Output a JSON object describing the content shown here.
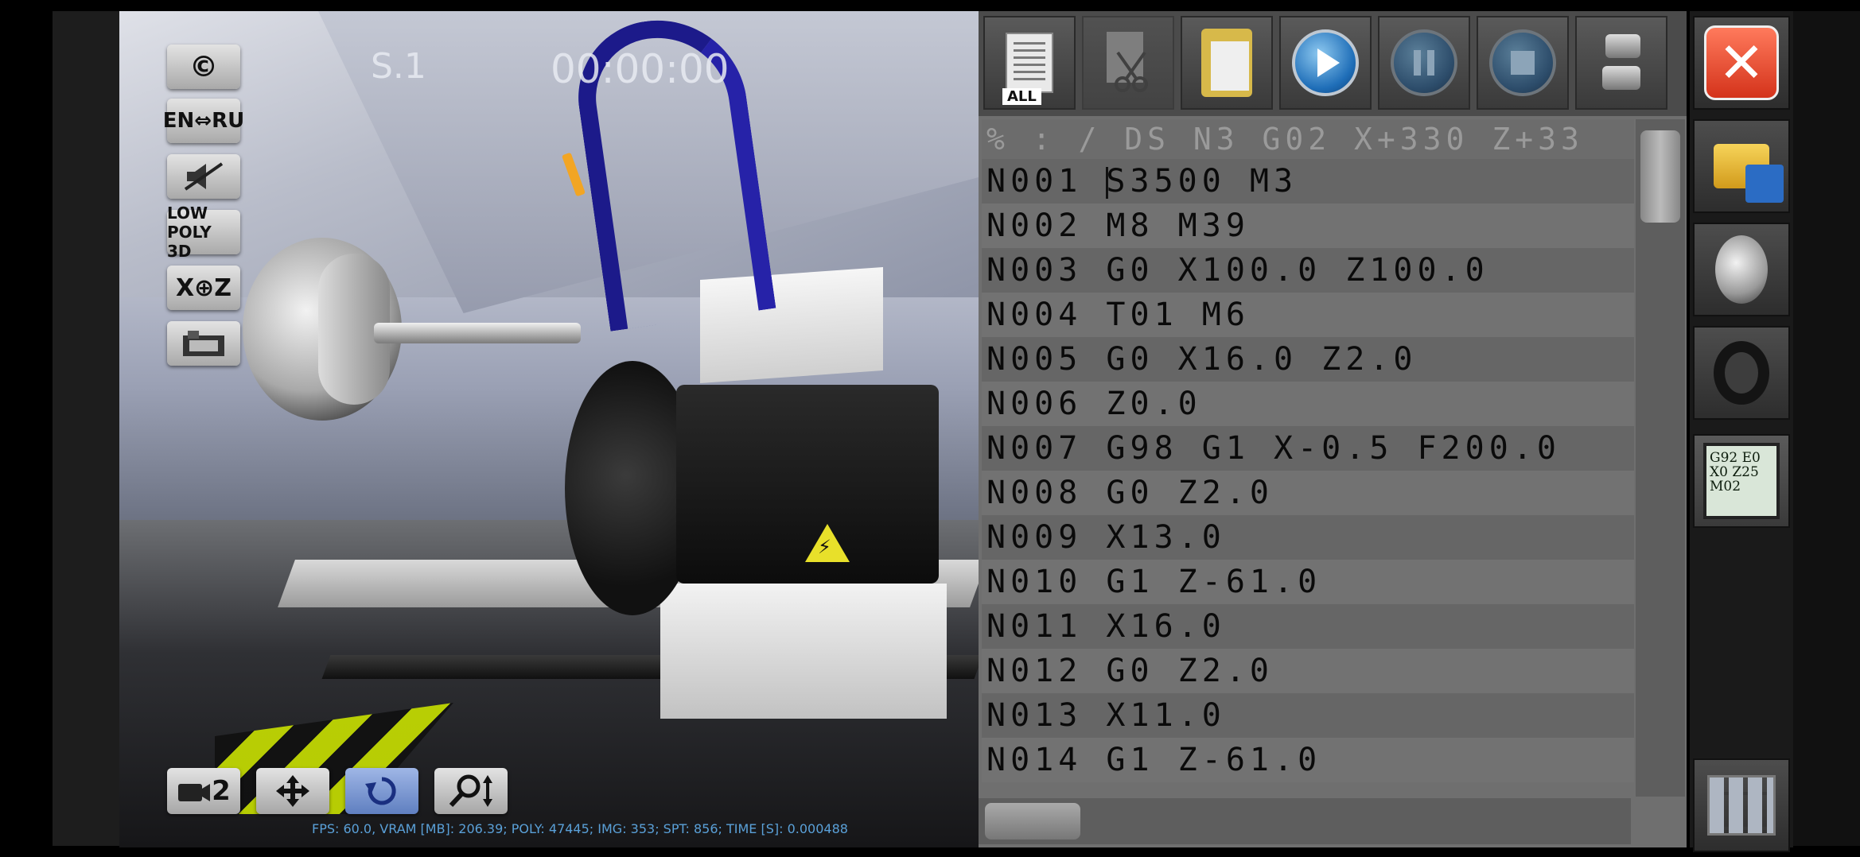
{
  "viewport": {
    "spindle_label": "S.1",
    "timer": "00:00:00",
    "stats": "FPS: 60.0, VRAM [MB]: 206.39; POLY: 47445; IMG: 353; SPT: 856; TIME [S]: 0.000488",
    "warning_glyph": "⚡"
  },
  "left_buttons": {
    "copyright": "©",
    "language": "EN⇔RU",
    "lowpoly": "LOW POLY 3D",
    "xz": "X⊕Z"
  },
  "bottom_buttons": {
    "camera": "2"
  },
  "toolbar": {
    "all_label": "ALL"
  },
  "editor": {
    "header": "% : / DS N3 G02 X+330 Z+33",
    "first_line_number": "N001",
    "first_line_code": "S3500 M3",
    "lines": [
      "N002 M8 M39",
      "N003 G0 X100.0 Z100.0",
      "N004 T01 M6",
      "N005 G0 X16.0 Z2.0",
      "N006 Z0.0",
      "N007 G98 G1 X-0.5 F200.0",
      "N008 G0 Z2.0",
      "N009 X13.0",
      "N010 G1 Z-61.0",
      "N011 X16.0",
      "N012 G0 Z2.0",
      "N013 X11.0",
      "N014 G1 Z-61.0"
    ]
  },
  "sidebar": {
    "close": "✕",
    "program_preview": [
      "G92 E0",
      "X0 Z25",
      "M02"
    ]
  },
  "colors": {
    "accent_blue": "#1f6eb8",
    "close_red": "#d4331b",
    "hose_blue": "#1c1a8a"
  }
}
